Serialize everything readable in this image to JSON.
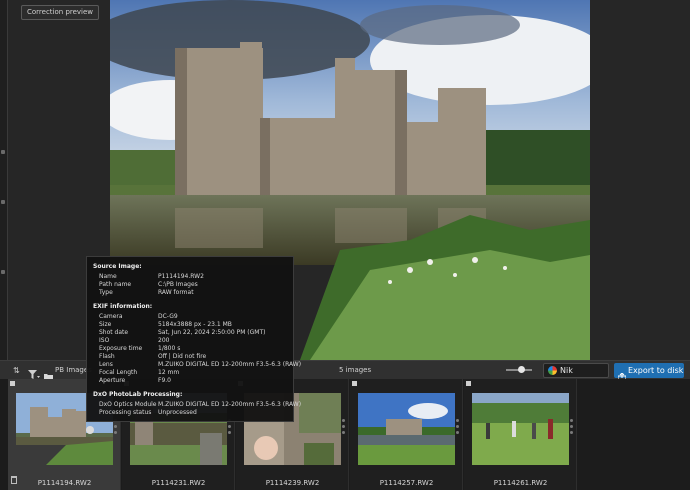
{
  "viewer": {
    "correction_preview_label": "Correction preview"
  },
  "toolbar": {
    "folder_label": "PB Images",
    "image_count": "5 images",
    "nik_label": "Nik Collection",
    "export_label": "Export to disk"
  },
  "info": {
    "source_title": "Source Image:",
    "source_rows": [
      {
        "k": "Name",
        "v": "P1114194.RW2"
      },
      {
        "k": "Path name",
        "v": "C:\\PB Images"
      },
      {
        "k": "Type",
        "v": "RAW format"
      }
    ],
    "exif_title": "EXIF information:",
    "exif_rows": [
      {
        "k": "Camera",
        "v": "DC-G9"
      },
      {
        "k": "Size",
        "v": "5184x3888  px - 23.1 MB"
      },
      {
        "k": "Shot date",
        "v": "Sat, Jun 22, 2024 2:50:00 PM (GMT)"
      },
      {
        "k": "ISO",
        "v": "200"
      },
      {
        "k": "Exposure time",
        "v": "1/800 s"
      },
      {
        "k": "Flash",
        "v": "Off | Did not fire"
      },
      {
        "k": "Lens",
        "v": "M.ZUIKO DIGITAL ED 12-200mm F3.5-6.3 (RAW)"
      },
      {
        "k": "Focal Length",
        "v": "12  mm"
      },
      {
        "k": "Aperture",
        "v": "F9.0"
      }
    ],
    "dxo_title": "DxO PhotoLab Processing:",
    "dxo_rows": [
      {
        "k": "DxO Optics Module",
        "v": "M.ZUIKO DIGITAL ED 12-200mm F3.5-6.3 (RAW)"
      },
      {
        "k": "Processing status",
        "v": "Unprocessed"
      }
    ]
  },
  "filmstrip": [
    {
      "name": "P1114194.RW2",
      "selected": true
    },
    {
      "name": "P1114231.RW2",
      "selected": false
    },
    {
      "name": "P1114239.RW2",
      "selected": false
    },
    {
      "name": "P1114257.RW2",
      "selected": false
    },
    {
      "name": "P1114261.RW2",
      "selected": false
    }
  ],
  "icons": {
    "sort": "sort-icon",
    "filter": "filter-icon",
    "folder": "folder-icon",
    "nik": "nik-logo-icon",
    "export": "export-icon",
    "trash": "trash-icon"
  },
  "colors": {
    "export_button": "#1f6fb2",
    "background": "#262626"
  }
}
